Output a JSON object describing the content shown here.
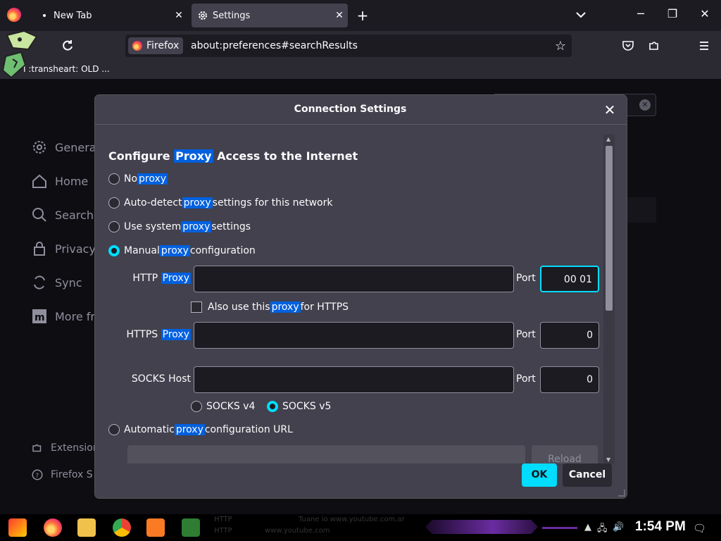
{
  "tabs": [
    {
      "label": "New Tab",
      "close": "✕"
    },
    {
      "label": "Settings",
      "close": "✕"
    }
  ],
  "tabbar": {
    "new_tab": "+",
    "list_all": "⌄",
    "minimize": "─",
    "restore": "❐",
    "close": "✕"
  },
  "urlbar": {
    "identity": "Firefox",
    "url": "about:preferences#searchResults",
    "star": "☆"
  },
  "bookmarks": {
    "item": "I :transheart: OLD ..."
  },
  "sidebar": {
    "items": [
      {
        "label": "General"
      },
      {
        "label": "Home"
      },
      {
        "label": "Search"
      },
      {
        "label": "Privacy"
      },
      {
        "label": "Sync"
      },
      {
        "label": "More fr"
      }
    ],
    "footer": [
      {
        "label": "Extension"
      },
      {
        "label": "Firefox S"
      }
    ]
  },
  "dialog": {
    "title": "Connection Settings",
    "close": "✕",
    "heading": {
      "pre": "Configure ",
      "hl": "Proxy",
      "post": " Access to the Internet"
    },
    "options": [
      {
        "pre": "No ",
        "hl": "proxy",
        "post": "",
        "selected": false
      },
      {
        "pre": "Auto-detect ",
        "hl": "proxy",
        "post": " settings for this network",
        "selected": false
      },
      {
        "pre": "Use system ",
        "hl": "proxy",
        "post": " settings",
        "selected": false
      },
      {
        "pre": "Manual ",
        "hl": "proxy",
        "post": " configuration",
        "selected": true
      }
    ],
    "http": {
      "label_pre": "HTTP ",
      "label_hl": "Proxy",
      "value": "",
      "port_label": "Port",
      "port_value": "00 01"
    },
    "also_https": {
      "pre": "Also use this ",
      "hl": "proxy",
      "post": " for HTTPS",
      "checked": false
    },
    "https": {
      "label_pre": "HTTPS ",
      "label_hl": "Proxy",
      "value": "",
      "port_label": "Port",
      "port_value": "0"
    },
    "socks": {
      "label": "SOCKS Host",
      "value": "",
      "port_label": "Port",
      "port_value": "0"
    },
    "socks_versions": [
      {
        "label": "SOCKS v4",
        "selected": false
      },
      {
        "label": "SOCKS v5",
        "selected": true
      }
    ],
    "auto_url": {
      "pre": "Automatic ",
      "hl": "proxy",
      "post": " configuration URL",
      "selected": false,
      "value": ""
    },
    "reload": "Reload",
    "ok": "OK",
    "cancel": "Cancel"
  },
  "taskbar": {
    "clock": "1:54 PM",
    "ghost_lines": [
      "HTTP",
      "HTTP",
      "www.youtube.com",
      "Tuane io  www.youtube.com.ar"
    ]
  },
  "colors": {
    "accent": "#00ddff",
    "highlight": "#0060df",
    "dialog_bg": "#42414d",
    "field_bg": "#1c1b22"
  }
}
